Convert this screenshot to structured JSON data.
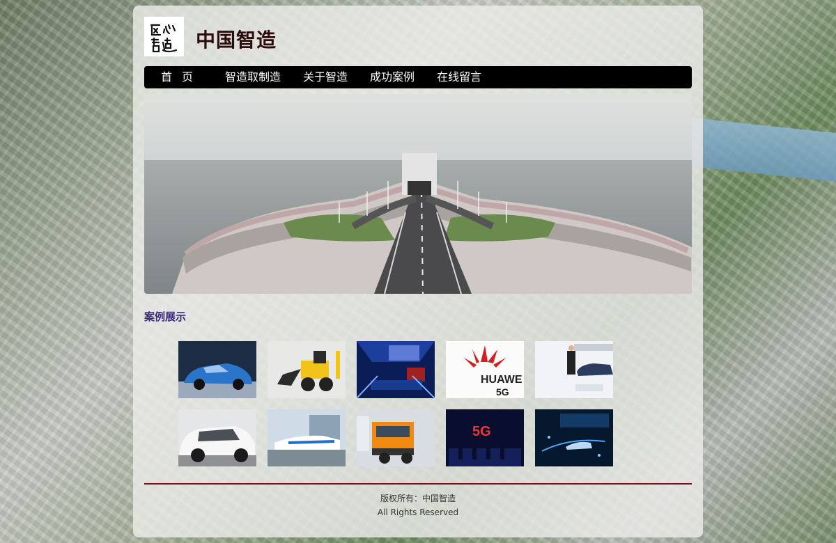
{
  "site": {
    "title": "中国智造",
    "logo_text": "匠心智造"
  },
  "nav": {
    "items": [
      {
        "label": "首页",
        "name": "nav-item-home"
      },
      {
        "label": "智造取制造",
        "name": "nav-item-replace"
      },
      {
        "label": "关于智造",
        "name": "nav-item-about"
      },
      {
        "label": "成功案例",
        "name": "nav-item-cases"
      },
      {
        "label": "在线留言",
        "name": "nav-item-message"
      }
    ]
  },
  "cases": {
    "title": "案例展示",
    "items": [
      {
        "name": "case-blue-car",
        "text": ""
      },
      {
        "name": "case-yellow-loader",
        "text": ""
      },
      {
        "name": "case-stage",
        "text": ""
      },
      {
        "name": "case-huawei",
        "text": "HUAWEI 5G"
      },
      {
        "name": "case-showroom",
        "text": ""
      },
      {
        "name": "case-white-suv",
        "text": ""
      },
      {
        "name": "case-maglev",
        "text": ""
      },
      {
        "name": "case-truck",
        "text": ""
      },
      {
        "name": "case-5g-event",
        "text": "5G"
      },
      {
        "name": "case-tech-event",
        "text": ""
      }
    ]
  },
  "footer": {
    "copyright": "版权所有：中国智造",
    "rights": "All Rights Reserved"
  },
  "colors": {
    "nav_bg": "#000000",
    "title": "#2a0a0a",
    "section_title": "#3a2a7a",
    "divider": "#7a1010"
  }
}
